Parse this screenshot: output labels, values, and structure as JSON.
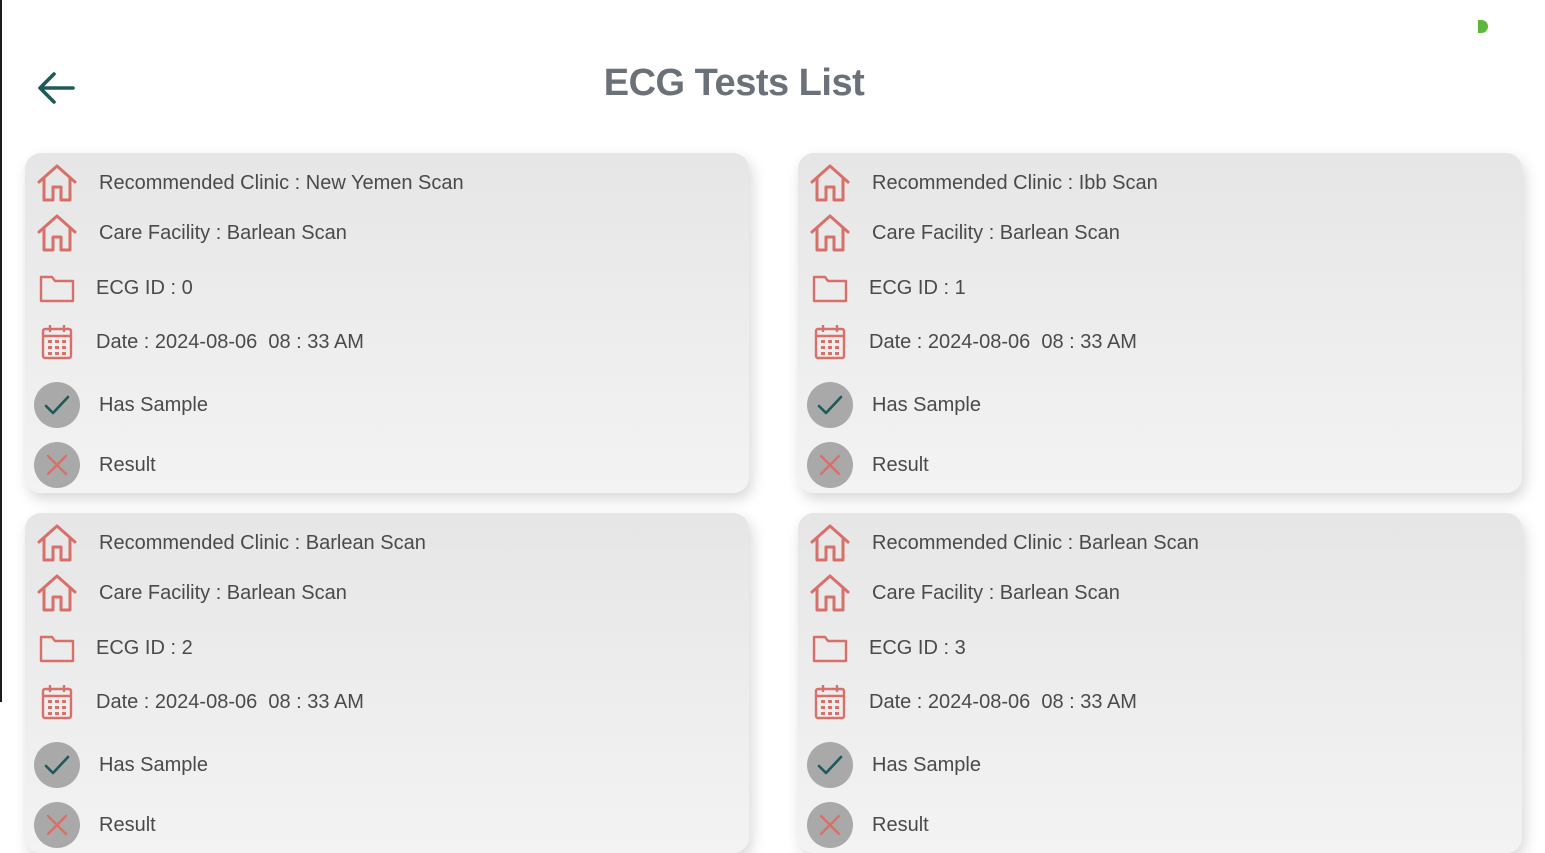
{
  "header": {
    "title": "ECG Tests List"
  },
  "cards": [
    {
      "clinic": "Recommended Clinic : New Yemen Scan",
      "facility": "Care Facility : Barlean Scan",
      "ecg_id": "ECG ID : 0",
      "date": "Date : 2024-08-06  08 : 33 AM",
      "has_sample": "Has Sample",
      "result": "Result"
    },
    {
      "clinic": "Recommended Clinic : Ibb Scan",
      "facility": "Care Facility : Barlean Scan",
      "ecg_id": "ECG ID : 1",
      "date": "Date : 2024-08-06  08 : 33 AM",
      "has_sample": "Has Sample",
      "result": "Result"
    },
    {
      "clinic": "Recommended Clinic : Barlean Scan",
      "facility": "Care Facility : Barlean Scan",
      "ecg_id": "ECG ID : 2",
      "date": "Date : 2024-08-06  08 : 33 AM",
      "has_sample": "Has Sample",
      "result": "Result"
    },
    {
      "clinic": "Recommended Clinic : Barlean Scan",
      "facility": "Care Facility : Barlean Scan",
      "ecg_id": "ECG ID : 3",
      "date": "Date : 2024-08-06  08 : 33 AM",
      "has_sample": "Has Sample",
      "result": "Result"
    }
  ],
  "colors": {
    "accent": "#d8706a",
    "title": "#6a7178",
    "back_arrow": "#1e5a5a",
    "check": "#1e5a5a",
    "circle": "#a9a9a9",
    "status_dot": "#5db83a"
  },
  "icons": {
    "back": "arrow-left-icon",
    "clinic": "home-icon",
    "facility": "home-icon",
    "ecg_id": "folder-icon",
    "date": "calendar-icon",
    "has_sample": "check-icon",
    "result": "close-icon"
  }
}
